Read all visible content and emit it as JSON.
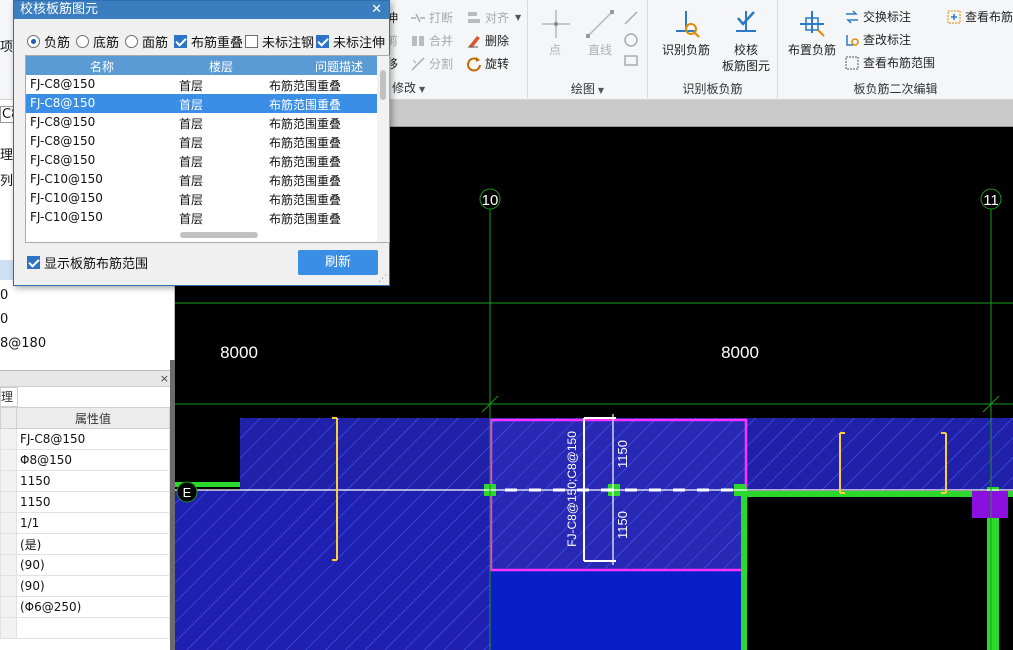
{
  "dialog": {
    "title": "校核板筋图元",
    "options": [
      {
        "type": "radio",
        "label": "负筋",
        "checked": true
      },
      {
        "type": "radio",
        "label": "底筋",
        "checked": false
      },
      {
        "type": "radio",
        "label": "面筋",
        "checked": false
      },
      {
        "type": "checkbox",
        "label": "布筋重叠",
        "checked": true
      },
      {
        "type": "checkbox",
        "label": "未标注钢",
        "checked": false
      },
      {
        "type": "checkbox",
        "label": "未标注伸",
        "checked": true
      }
    ],
    "columns": [
      "名称",
      "楼层",
      "问题描述"
    ],
    "rows": [
      {
        "name": "FJ-C8@150",
        "floor": "首层",
        "issue": "布筋范围重叠"
      },
      {
        "name": "FJ-C8@150",
        "floor": "首层",
        "issue": "布筋范围重叠"
      },
      {
        "name": "FJ-C8@150",
        "floor": "首层",
        "issue": "布筋范围重叠"
      },
      {
        "name": "FJ-C8@150",
        "floor": "首层",
        "issue": "布筋范围重叠"
      },
      {
        "name": "FJ-C8@150",
        "floor": "首层",
        "issue": "布筋范围重叠"
      },
      {
        "name": "FJ-C10@150",
        "floor": "首层",
        "issue": "布筋范围重叠"
      },
      {
        "name": "FJ-C10@150",
        "floor": "首层",
        "issue": "布筋范围重叠"
      },
      {
        "name": "FJ-C10@150",
        "floor": "首层",
        "issue": "布筋范围重叠"
      }
    ],
    "selected_row": 1,
    "show_range_label": "显示板筋布筋范围",
    "show_range_checked": true,
    "refresh_label": "刷新"
  },
  "ribbon": {
    "modify": {
      "items": [
        "伸",
        "打断",
        "对齐",
        "剪",
        "合并",
        "删除",
        "移",
        "分割",
        "旋转"
      ],
      "label": "修改"
    },
    "draw": {
      "items": [
        "点",
        "直线"
      ],
      "label": "绘图"
    },
    "identify": {
      "items": [
        "识别负筋"
      ],
      "label": "识别板负筋"
    },
    "check": {
      "line1": "校核",
      "line2": "板筋图元"
    },
    "second_edit": {
      "large": "布置负筋",
      "items": [
        "交换标注",
        "查看布筋",
        "查改标注",
        "查看布筋范围"
      ],
      "label": "板负筋二次编辑"
    }
  },
  "left_panel": {
    "cut_text": [
      "C8",
      "项",
      "理",
      "列",
      "0",
      "0",
      "8@180"
    ],
    "tab": "理",
    "close_glyph": "×",
    "property_header": "属性值",
    "property_values": [
      "FJ-C8@150",
      "Φ8@150",
      "1150",
      "1150",
      "1/1",
      "(是)",
      "(90)",
      "(90)",
      "(Φ6@250)",
      ""
    ]
  },
  "canvas": {
    "axis_labels": [
      "10",
      "11"
    ],
    "row_label": "E",
    "dimension_labels": [
      "8000",
      "8000"
    ],
    "rebar_label": "FJ-C8@150;C8@150",
    "rebar_dims": [
      "1150",
      "1150"
    ]
  },
  "colors": {
    "dialog_title": "#3a7ebf",
    "selection": "#3a8ee6",
    "slab": "#1f1fa8",
    "highlight": "#ff32ff",
    "beam": "#2bd82b"
  }
}
